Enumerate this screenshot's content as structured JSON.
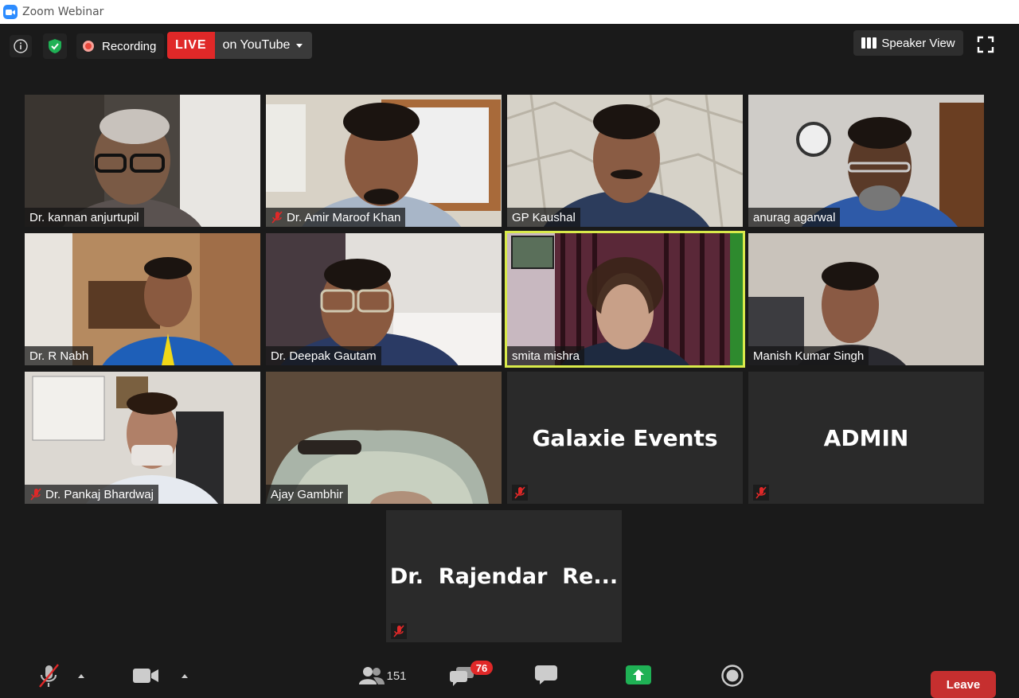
{
  "window": {
    "title": "Zoom Webinar"
  },
  "topbar": {
    "recording_label": "Recording",
    "live_badge": "LIVE",
    "live_target": "on YouTube",
    "view_button": "Speaker View"
  },
  "participants": [
    {
      "name": "Dr. kannan anjurtupil",
      "muted": false
    },
    {
      "name": "Dr. Amir Maroof Khan",
      "muted": true
    },
    {
      "name": "GP Kaushal",
      "muted": false
    },
    {
      "name": "anurag agarwal",
      "muted": false
    },
    {
      "name": "Dr. R Nabh",
      "muted": false
    },
    {
      "name": "Dr. Deepak Gautam",
      "muted": false
    },
    {
      "name": "smita mishra",
      "muted": false,
      "active_speaker": true
    },
    {
      "name": "Manish Kumar Singh",
      "muted": false
    },
    {
      "name": "Dr. Pankaj Bhardwaj",
      "muted": true
    },
    {
      "name": "Ajay Gambhir",
      "muted": false
    },
    {
      "name": "Galaxie Events",
      "muted": true,
      "video_off": true
    },
    {
      "name": "ADMIN",
      "muted": true,
      "video_off": true
    },
    {
      "name": "Dr.  Rajendar  Re...",
      "muted": true,
      "video_off": true
    }
  ],
  "toolbar": {
    "participants_count": "151",
    "qa_badge": "76",
    "leave_label": "Leave"
  },
  "colors": {
    "accent": "#2d8cff",
    "live": "#e02828",
    "active_border": "#d9ea4a",
    "share_green": "#1fb155"
  }
}
